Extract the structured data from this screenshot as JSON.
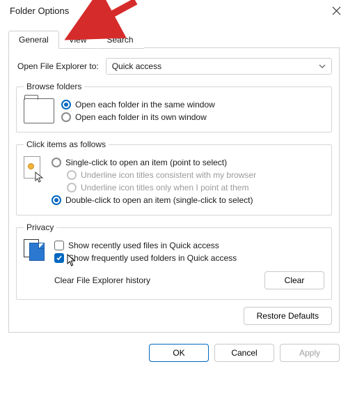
{
  "title": "Folder Options",
  "tabs": {
    "general": "General",
    "view": "View",
    "search": "Search"
  },
  "open_to": {
    "label": "Open File Explorer to:",
    "value": "Quick access"
  },
  "browse": {
    "legend": "Browse folders",
    "opt_same": "Open each folder in the same window",
    "opt_own": "Open each folder in its own window"
  },
  "click": {
    "legend": "Click items as follows",
    "single": "Single-click to open an item (point to select)",
    "ul_browser": "Underline icon titles consistent with my browser",
    "ul_point": "Underline icon titles only when I point at them",
    "double": "Double-click to open an item (single-click to select)"
  },
  "privacy": {
    "legend": "Privacy",
    "recent": "Show recently used files in Quick access",
    "frequent": "Show frequently used folders in Quick access",
    "clear_label": "Clear File Explorer history",
    "clear_btn": "Clear"
  },
  "restore": "Restore Defaults",
  "buttons": {
    "ok": "OK",
    "cancel": "Cancel",
    "apply": "Apply"
  }
}
